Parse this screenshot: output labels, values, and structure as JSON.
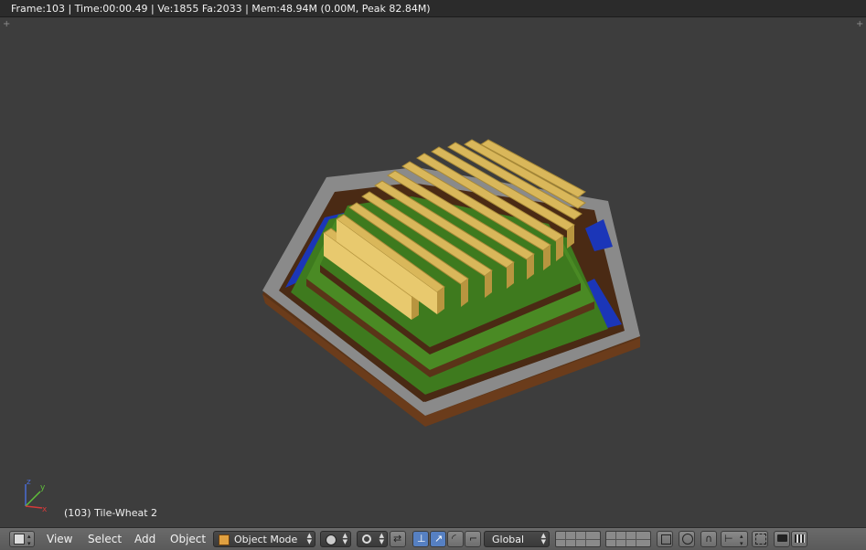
{
  "status": {
    "text": "Frame:103 | Time:00:00.49 | Ve:1855 Fa:2033 | Mem:48.94M (0.00M, Peak 82.84M)"
  },
  "viewport": {
    "object_label": "(103) Tile-Wheat 2",
    "axis_labels": {
      "x": "x",
      "y": "y",
      "z": "z"
    }
  },
  "toolbar": {
    "menus": {
      "view": "View",
      "select": "Select",
      "add": "Add",
      "object": "Object"
    },
    "mode": "Object Mode",
    "orientation": "Global"
  },
  "colors": {
    "background": "#3d3d3d",
    "wheat": "#d9b75a",
    "grass": "#3e7a1e",
    "dirt": "#5a3418",
    "water": "#1b36b8",
    "border": "#8a8a8a"
  }
}
